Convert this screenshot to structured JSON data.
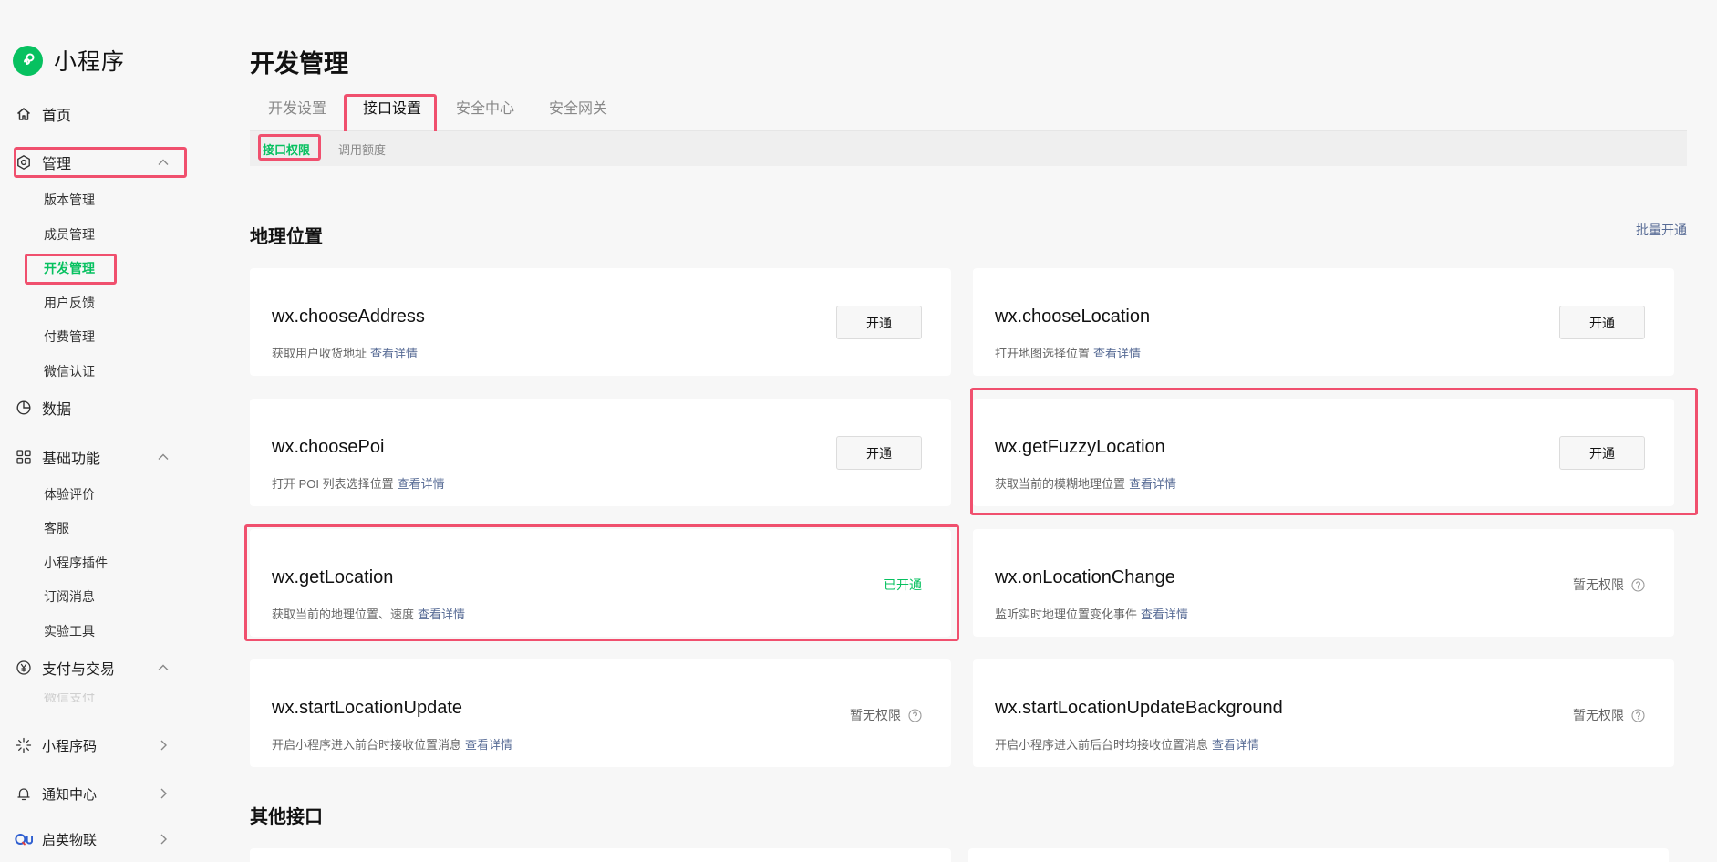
{
  "app": {
    "title": "小程序"
  },
  "nav": {
    "home": "首页",
    "manage": {
      "label": "管理",
      "children": [
        "版本管理",
        "成员管理",
        "开发管理",
        "用户反馈",
        "付费管理",
        "微信认证"
      ]
    },
    "data": "数据",
    "basic": {
      "label": "基础功能",
      "children": [
        "体验评价",
        "客服",
        "小程序插件",
        "订阅消息",
        "实验工具"
      ]
    },
    "pay": {
      "label": "支付与交易",
      "children": [
        "微信支付"
      ]
    },
    "qrcode": "小程序码",
    "notify": "通知中心",
    "qiying": "启英物联"
  },
  "page": {
    "title": "开发管理",
    "tabs": [
      "开发设置",
      "接口设置",
      "安全中心",
      "安全网关"
    ],
    "active_tab": "接口设置",
    "subtabs": [
      "接口权限",
      "调用额度"
    ],
    "active_subtab": "接口权限"
  },
  "sections": {
    "location": {
      "title": "地理位置",
      "batch_action": "批量开通"
    },
    "other": {
      "title": "其他接口"
    }
  },
  "labels": {
    "detail_link": "查看详情",
    "open_button": "开通",
    "opened": "已开通",
    "no_permission": "暂无权限"
  },
  "apis": [
    {
      "name": "wx.chooseAddress",
      "desc": "获取用户收货地址",
      "status": "open_button"
    },
    {
      "name": "wx.chooseLocation",
      "desc": "打开地图选择位置",
      "status": "open_button"
    },
    {
      "name": "wx.choosePoi",
      "desc": "打开 POI 列表选择位置",
      "status": "open_button"
    },
    {
      "name": "wx.getFuzzyLocation",
      "desc": "获取当前的模糊地理位置",
      "status": "open_button"
    },
    {
      "name": "wx.getLocation",
      "desc": "获取当前的地理位置、速度",
      "status": "opened"
    },
    {
      "name": "wx.onLocationChange",
      "desc": "监听实时地理位置变化事件",
      "status": "no_permission"
    },
    {
      "name": "wx.startLocationUpdate",
      "desc": "开启小程序进入前台时接收位置消息",
      "status": "no_permission"
    },
    {
      "name": "wx.startLocationUpdateBackground",
      "desc": "开启小程序进入前后台时均接收位置消息",
      "status": "no_permission"
    }
  ],
  "colors": {
    "brand": "#07c160",
    "link": "#576b95",
    "highlight": "#f0506e",
    "background": "#f7f7f7"
  },
  "icons": [
    "miniprogram-logo-icon",
    "home-icon",
    "manage-gear-icon",
    "data-clock-icon",
    "grid-icon",
    "yen-icon",
    "sparkle-icon",
    "bell-icon",
    "qiying-logo-icon",
    "chevron-up-icon",
    "chevron-right-icon",
    "question-circle-icon"
  ]
}
